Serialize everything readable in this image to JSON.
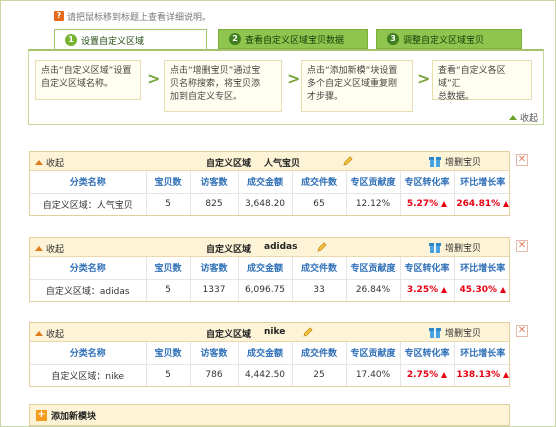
{
  "hint": {
    "text": "请把鼠标移到标题上查看详细说明。"
  },
  "tabs": [
    {
      "num": "1",
      "label": "设置自定义区域"
    },
    {
      "num": "2",
      "label": "查看自定义区域宝贝数据"
    },
    {
      "num": "3",
      "label": "调整自定义区域宝贝"
    }
  ],
  "steps": [
    {
      "line1": "点击“自定义区域”设置",
      "line2": "自定义区域名称。",
      "line3": ""
    },
    {
      "line1": "点击“增删宝贝”通过宝",
      "line2": "贝名称搜索，将宝贝添",
      "line3": "加到自定义专区。"
    },
    {
      "line1": "点击“添加新模”块设置",
      "line2": "多个自定义区域重复刚",
      "line3": "才步骤。"
    },
    {
      "line1": "查看“自定义各区域”汇",
      "line2": "总数据。",
      "line3": ""
    }
  ],
  "collapse_label": "收起",
  "modules": [
    {
      "collapse": "收起",
      "title": "自定义区域",
      "name": "人气宝贝",
      "add_label": "增删宝贝",
      "headers": [
        "分类名称",
        "宝贝数",
        "访客数",
        "成交金额",
        "成交件数",
        "专区贡献度",
        "专区转化率",
        "环比增长率"
      ],
      "row": [
        "自定义区域：人气宝贝",
        "5",
        "825",
        "3,648.20",
        "65",
        "12.12%",
        "5.27%",
        "264.81%"
      ]
    },
    {
      "collapse": "收起",
      "title": "自定义区域",
      "name": "adidas",
      "add_label": "增删宝贝",
      "headers": [
        "分类名称",
        "宝贝数",
        "访客数",
        "成交金额",
        "成交件数",
        "专区贡献度",
        "专区转化率",
        "环比增长率"
      ],
      "row": [
        "自定义区域：adidas",
        "5",
        "1337",
        "6,096.75",
        "33",
        "26.84%",
        "3.25%",
        "45.30%"
      ]
    },
    {
      "collapse": "收起",
      "title": "自定义区域",
      "name": "nike",
      "add_label": "增删宝贝",
      "headers": [
        "分类名称",
        "宝贝数",
        "访客数",
        "成交金额",
        "成交件数",
        "专区贡献度",
        "专区转化率",
        "环比增长率"
      ],
      "row": [
        "自定义区域：nike",
        "5",
        "786",
        "4,442.50",
        "25",
        "17.40%",
        "2.75%",
        "138.13%"
      ]
    }
  ],
  "add_module": {
    "label": "添加新模块"
  },
  "close_glyph": "✕"
}
